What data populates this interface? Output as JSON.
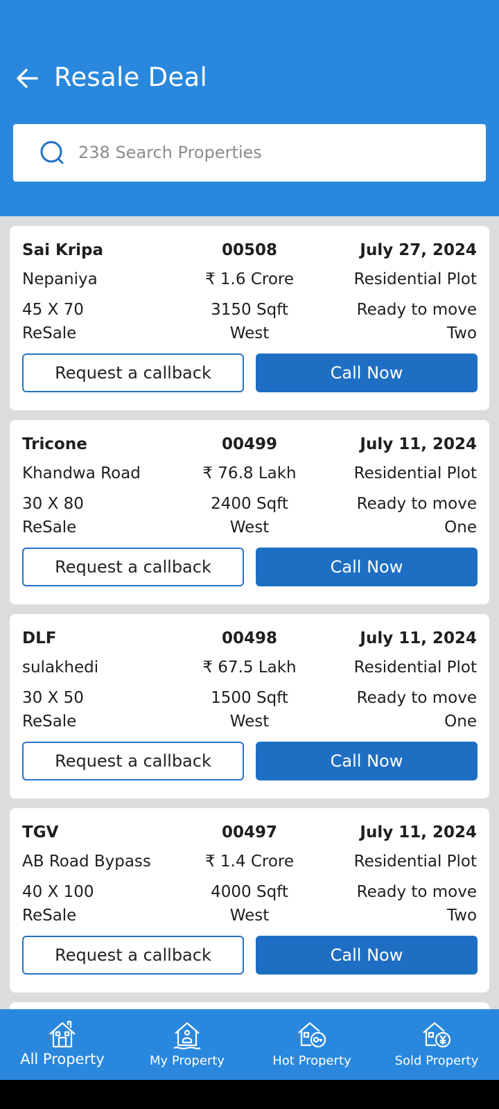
{
  "header": {
    "title": "Resale Deal",
    "search_placeholder": "238 Search Properties",
    "bg_color": "#2988dd"
  },
  "listings": [
    {
      "name": "Sai Kripa",
      "code": "00508",
      "date": "July 27, 2024",
      "location": "Nepaniya",
      "price": "₹ 1.6 Crore",
      "category": "Residential Plot",
      "dimensions": "45 X 70",
      "area": "3150 Sqft",
      "status": "Ready to move",
      "deal_type": "ReSale",
      "facing": "West",
      "count": "Two"
    },
    {
      "name": "Tricone",
      "code": "00499",
      "date": "July 11, 2024",
      "location": "Khandwa Road",
      "price": "₹ 76.8 Lakh",
      "category": "Residential Plot",
      "dimensions": "30 X 80",
      "area": "2400 Sqft",
      "status": "Ready to move",
      "deal_type": "ReSale",
      "facing": "West",
      "count": "One"
    },
    {
      "name": "DLF",
      "code": "00498",
      "date": "July 11, 2024",
      "location": "sulakhedi",
      "price": "₹ 67.5 Lakh",
      "category": "Residential Plot",
      "dimensions": "30 X 50",
      "area": "1500 Sqft",
      "status": "Ready to move",
      "deal_type": "ReSale",
      "facing": "West",
      "count": "One"
    },
    {
      "name": "TGV",
      "code": "00497",
      "date": "July 11, 2024",
      "location": "AB Road Bypass",
      "price": "₹ 1.4 Crore",
      "category": "Residential Plot",
      "dimensions": "40 X 100",
      "area": "4000 Sqft",
      "status": "Ready to move",
      "deal_type": "ReSale",
      "facing": "West",
      "count": "Two"
    }
  ],
  "buttons": {
    "callback": "Request a callback",
    "call": "Call Now",
    "call_color": "#1e6fc3"
  },
  "bottom_nav": {
    "items": [
      {
        "label": "All Property",
        "icon": "all-property-icon",
        "active": true
      },
      {
        "label": "My Property",
        "icon": "my-property-icon",
        "active": false
      },
      {
        "label": "Hot Property",
        "icon": "hot-property-icon",
        "active": false
      },
      {
        "label": "Sold Property",
        "icon": "sold-property-icon",
        "active": false
      }
    ]
  }
}
